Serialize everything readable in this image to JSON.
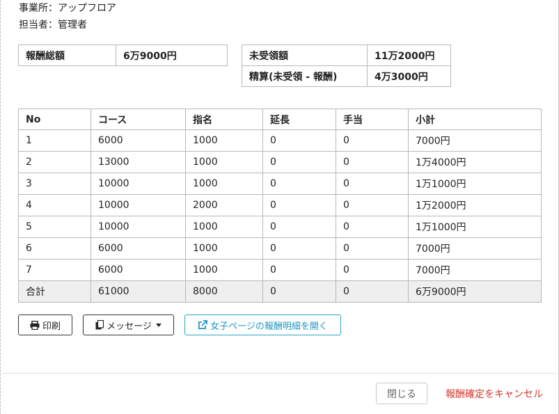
{
  "info": {
    "office_label": "事業所：",
    "office_value": "アップフロア",
    "staff_label": "担当者：",
    "staff_value": "管理者"
  },
  "summary_left": {
    "label": "報酬総額",
    "value": "6万9000円"
  },
  "summary_right": [
    {
      "label": "未受領額",
      "value": "11万2000円"
    },
    {
      "label": "精算(未受領 - 報酬)",
      "value": "4万3000円"
    }
  ],
  "table": {
    "headers": [
      "No",
      "コース",
      "指名",
      "延長",
      "手当",
      "小計"
    ],
    "rows": [
      [
        "1",
        "6000",
        "1000",
        "0",
        "0",
        "7000円"
      ],
      [
        "2",
        "13000",
        "1000",
        "0",
        "0",
        "1万4000円"
      ],
      [
        "3",
        "10000",
        "1000",
        "0",
        "0",
        "1万1000円"
      ],
      [
        "4",
        "10000",
        "2000",
        "0",
        "0",
        "1万2000円"
      ],
      [
        "5",
        "10000",
        "1000",
        "0",
        "0",
        "1万1000円"
      ],
      [
        "6",
        "6000",
        "1000",
        "0",
        "0",
        "7000円"
      ],
      [
        "7",
        "6000",
        "1000",
        "0",
        "0",
        "7000円"
      ]
    ],
    "total": [
      "合計",
      "61000",
      "8000",
      "0",
      "0",
      "6万9000円"
    ]
  },
  "actions": {
    "print_label": "印刷",
    "message_label": "メッセージ",
    "open_label": "女子ページの報酬明細を開く"
  },
  "footer": {
    "close_label": "閉じる",
    "cancel_label": "報酬確定をキャンセル"
  },
  "icons": [
    "print-icon",
    "copy-icon",
    "external-link-icon"
  ],
  "colors": {
    "link_blue": "#2196c4",
    "danger_red": "#d9342b",
    "total_row_bg": "#efefef"
  }
}
